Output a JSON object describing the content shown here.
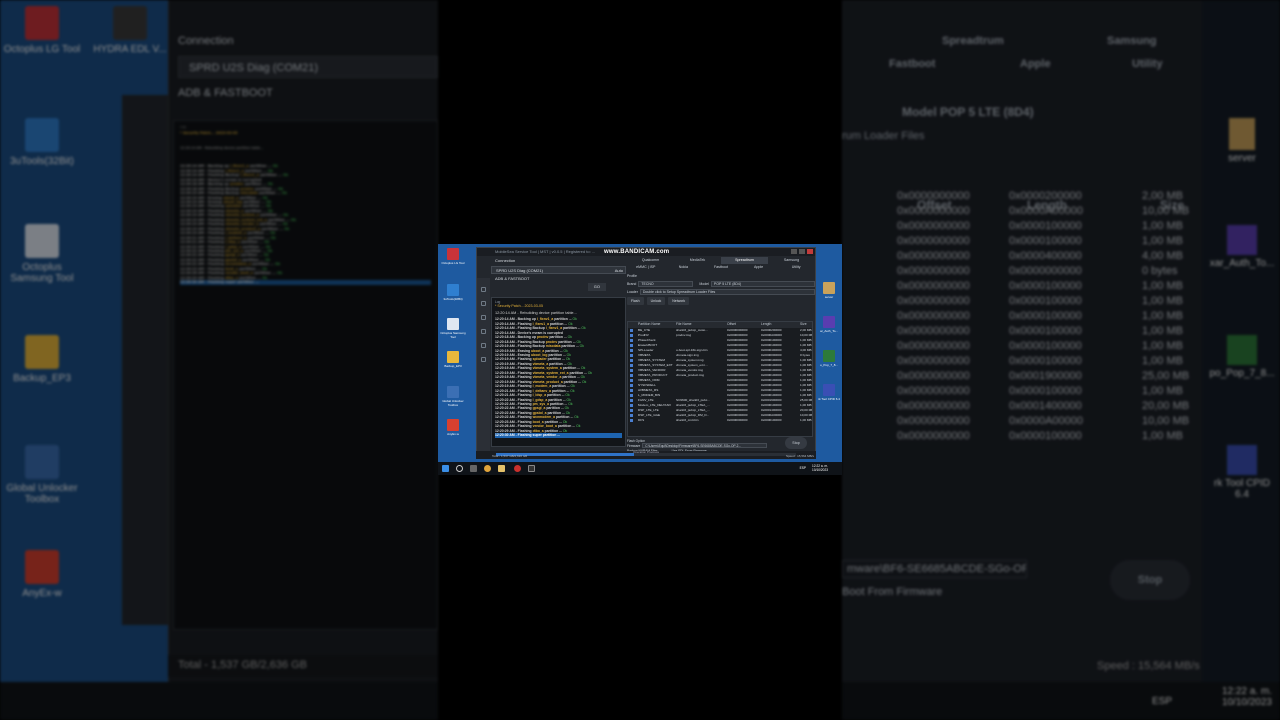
{
  "recording_watermark": "www.BANDICAM.com",
  "left_bg": {
    "connection_label": "Connection",
    "port_value": "SPRD U2S Diag (COM21)",
    "adb_label": "ADB & FASTBOOT",
    "log_label": "Log",
    "security_patch": "* Security Patch... 2023-03-05",
    "desktop_icons": [
      "Octoplus LG Tool",
      "HYDRA EDL V...",
      "3uTools(32Bit)",
      "Octoplus Samsung Tool",
      "Backup_EP3",
      "Global Unlocker Toolbox",
      "AnyEx-w"
    ],
    "total": "Total - 1,537 GB/2,636 GB"
  },
  "right_bg": {
    "tabs_row1": [
      "Spreadtrum",
      "Samsung"
    ],
    "tabs_row2": [
      "Fastboot",
      "Apple",
      "Utility"
    ],
    "model": "Model  POP 5 LTE (8D4)",
    "loader_hint": "rum Loader Files",
    "col_headers": [
      "Offset",
      "Length",
      "Size"
    ],
    "rows": [
      [
        "0x0000000000",
        "0x0000200000",
        "2,00 MB"
      ],
      [
        "0x0000000000",
        "0x0000A00000",
        "10,00 MB"
      ],
      [
        "0x0000000000",
        "0x0000100000",
        "1,00 MB"
      ],
      [
        "0x0000000000",
        "0x0000100000",
        "1,00 MB"
      ],
      [
        "0x0000000000",
        "0x0000400000",
        "4,00 MB"
      ],
      [
        "0x0000000000",
        "0x0000000000",
        "0 bytes"
      ],
      [
        "0x0000000000",
        "0x0000100000",
        "1,00 MB"
      ],
      [
        "0x0000000000",
        "0x0000100000",
        "1,00 MB"
      ],
      [
        "0x0000000000",
        "0x0000100000",
        "1,00 MB"
      ],
      [
        "0x0000000000",
        "0x0000100000",
        "1,00 MB"
      ],
      [
        "0x0000000000",
        "0x0000100000",
        "1,00 MB"
      ],
      [
        "0x0000000000",
        "0x0000100000",
        "1,00 MB"
      ],
      [
        "0x0000000000",
        "0x0001900000",
        "25,00 MB"
      ],
      [
        "0x0000000000",
        "0x0000100000",
        "1,00 MB"
      ],
      [
        "0x0000000000",
        "0x0001400000",
        "20,00 MB"
      ],
      [
        "0x0000000000",
        "0x0000A00000",
        "10,00 MB"
      ],
      [
        "0x0000000000",
        "0x0000100000",
        "1,00 MB"
      ]
    ],
    "firmware_path": "mware\\BF6-SE6685ABCDE-SGo-OP-2",
    "from_firmware": "Boot From Firmware",
    "stop_label": "Stop",
    "speed": "Speed : 15,564 MB/s",
    "clock_time": "12:22 a. m.",
    "clock_date": "10/10/2023",
    "lang": "ESP",
    "desktop_icons": [
      "server",
      "xar_Auth_To...",
      "po_Pop_7_8...",
      "rk Tool CPID 6.4"
    ]
  },
  "app": {
    "title": "MobileSea Service Tool | MST | v0.0.5 | Registered to: ...",
    "connection_label": "Connection",
    "port_value": "SPRD U2S Diag (COM21)",
    "auto_label": "Auto",
    "adb_label": "ADB & FASTBOOT",
    "go_label": "GO",
    "log_label": "Log",
    "security_patch": "* Security Patch... 2023-03-05",
    "log_big": "12:20:14 AM - Rebuilding device partition table...",
    "log_lines": [
      {
        "t": "12:20:14 AM - Backing up ",
        "p": "l_fixnv1_a",
        "r": " partition ... ",
        "ok": "Ok"
      },
      {
        "t": "12:20:14 AM - Flashing ",
        "p": "l_fixnv1_a",
        "r": " partition ... ",
        "ok": "Ok"
      },
      {
        "t": "12:20:14 AM - Flashing Backup ",
        "p": "l_fixnv1_a",
        "r": " partition ... ",
        "ok": "Ok"
      },
      {
        "t": "12:20:14 AM - Device's nvram is currupted",
        "p": "",
        "r": "",
        "ok": ""
      },
      {
        "t": "12:20:18 AM - Backing up ",
        "p": "prodnv",
        "r": " partition ... ",
        "ok": "Ok"
      },
      {
        "t": "12:20:18 AM - Flashing Backup ",
        "p": "prodnv",
        "r": " partition ... ",
        "ok": "Ok"
      },
      {
        "t": "12:20:19 AM - Flashing Backup ",
        "p": "miscdata",
        "r": " partition ... ",
        "ok": "Ok"
      },
      {
        "t": "12:20:19 AM - Erasing ",
        "p": "uboot_a",
        "r": " partition ... ",
        "ok": "Ok"
      },
      {
        "t": "12:20:19 AM - Erasing ",
        "p": "uboot_log",
        "r": " partition ... ",
        "ok": "Ok"
      },
      {
        "t": "12:20:19 AM - Flashing ",
        "p": "sploader",
        "r": " partition ... ",
        "ok": "Ok"
      },
      {
        "t": "12:20:19 AM - Flashing ",
        "p": "vbmeta_a",
        "r": " partition ... ",
        "ok": "Ok"
      },
      {
        "t": "12:20:19 AM - Flashing ",
        "p": "vbmeta_system_a",
        "r": " partition ... ",
        "ok": "Ok"
      },
      {
        "t": "12:20:19 AM - Flashing ",
        "p": "vbmeta_system_ext_a",
        "r": " partition ... ",
        "ok": "Ok"
      },
      {
        "t": "12:20:19 AM - Flashing ",
        "p": "vbmeta_vendor_a",
        "r": " partition ... ",
        "ok": "Ok"
      },
      {
        "t": "12:20:19 AM - Flashing ",
        "p": "vbmeta_product_a",
        "r": " partition ... ",
        "ok": "Ok"
      },
      {
        "t": "12:20:19 AM - Flashing ",
        "p": "l_modem_a",
        "r": " partition ... ",
        "ok": "Ok"
      },
      {
        "t": "12:20:21 AM - Flashing ",
        "p": "l_deltanv_a",
        "r": " partition ... ",
        "ok": "Ok"
      },
      {
        "t": "12:20:21 AM - Flashing ",
        "p": "l_ldsp_a",
        "r": " partition ... ",
        "ok": "Ok"
      },
      {
        "t": "12:20:22 AM - Flashing ",
        "p": "l_gdsp_a",
        "r": " partition ... ",
        "ok": "Ok"
      },
      {
        "t": "12:20:22 AM - Flashing ",
        "p": "pm_sys_a",
        "r": " partition ... ",
        "ok": "Ok"
      },
      {
        "t": "12:20:22 AM - Flashing ",
        "p": "gpsgl_a",
        "r": " partition ... ",
        "ok": "Ok"
      },
      {
        "t": "12:20:22 AM - Flashing ",
        "p": "gpsbd_a",
        "r": " partition ... ",
        "ok": "Ok"
      },
      {
        "t": "12:20:22 AM - Flashing ",
        "p": "wcnmodem_a",
        "r": " partition ... ",
        "ok": "Ok"
      },
      {
        "t": "12:20:23 AM - Flashing ",
        "p": "boot_a",
        "r": " partition ... ",
        "ok": "Ok"
      },
      {
        "t": "12:20:26 AM - Flashing ",
        "p": "vendor_boot_a",
        "r": " partition ... ",
        "ok": "Ok"
      },
      {
        "t": "12:20:29 AM - Flashing ",
        "p": "dtbo_a",
        "r": " partition ... ",
        "ok": "Ok"
      }
    ],
    "log_current": "12:20:30 AM - Flashing super partition ...",
    "tabs_row1": [
      "Qualcomm",
      "MediaTek",
      "Spreadtrum",
      "Samsung"
    ],
    "tabs_row2": [
      "eMMC | ISP",
      "Nokia",
      "Fastboot",
      "Apple",
      "Utility"
    ],
    "profile_label": "Profile",
    "brand_label": "Brand",
    "brand_value": "TECNO",
    "model_label": "Model",
    "model_value": "POP 5 LTE (8D4)",
    "loader_label": "Loader",
    "loader_value": "Double click to Setup Spreadtrum Loader Files",
    "buttons": [
      "Flash",
      "Unlock",
      "Network"
    ],
    "table_headers": [
      "Partition Name",
      "File Name",
      "Offset",
      "Length",
      "Size"
    ],
    "table_rows": [
      [
        "BE_CTE",
        "sharkl3_pubcp_custo...",
        "0x0000000000",
        "0x0000200000",
        "2,00 MB"
      ],
      [
        "ProdNV",
        "prodnv.img",
        "0x0000000000",
        "0x0000A00000",
        "10,00 MB"
      ],
      [
        "PhaseCheck",
        "",
        "0x0000000000",
        "0x0000100000",
        "1,00 MB"
      ],
      [
        "EraseUBOOT",
        "",
        "0x0000000000",
        "0x0000100000",
        "1,00 MB"
      ],
      [
        "SPLLoader",
        "u-boot-spl-16k-sign.bin",
        "0x0000000000",
        "0x0000400000",
        "4,00 MB"
      ],
      [
        "VBMETA",
        "vbmeta-sign.img",
        "0x0000000000",
        "0x0000000000",
        "0 bytes"
      ],
      [
        "VBMETA_SYSTEM",
        "vbmeta_system.img",
        "0x0000000000",
        "0x0000100000",
        "1,00 MB"
      ],
      [
        "VBMETA_SYSTEM_EXT",
        "vbmeta_system_ext.i...",
        "0x0000000000",
        "0x0000100000",
        "1,00 MB"
      ],
      [
        "VBMETA_VENDOR",
        "vbmeta_vendor.img",
        "0x0000000000",
        "0x0000100000",
        "1,00 MB"
      ],
      [
        "VBMETA_PRODUCT",
        "vbmeta_product.img",
        "0x0000000000",
        "0x0000100000",
        "1,00 MB"
      ],
      [
        "VBMETA_ODM",
        "",
        "0x0000000000",
        "0x0000100000",
        "1,00 MB"
      ],
      [
        "SYSFSDELL",
        "",
        "0x0000000000",
        "0x0000100000",
        "1,00 MB"
      ],
      [
        "AVBMETA_RS",
        "",
        "0x0000000000",
        "0x0000100000",
        "1,00 MB"
      ],
      [
        "L_MODEM_BIN",
        "",
        "0x0000000000",
        "0x0000100000",
        "1,00 MB"
      ],
      [
        "FixNV_LTE",
        "SC9600_sharkl3_pubc...",
        "0x0000000000",
        "0x0001900000",
        "25,00 MB"
      ],
      [
        "Modem_LTE_DELTANV",
        "sharkl3_pubcp_LTEA_...",
        "0x0000000000",
        "0x0000100000",
        "1,00 MB"
      ],
      [
        "DSP_LTE_LTE",
        "sharkl3_pubcp_LTEA_...",
        "0x0000000000",
        "0x0001400000",
        "20,00 MB"
      ],
      [
        "DSP_LTE_GGE",
        "sharkl3_pubcp_DM_D...",
        "0x0000000000",
        "0x0000A00000",
        "10,00 MB"
      ],
      [
        "DFS",
        "sharkl3_cm4.bin",
        "0x0000000000",
        "0x0000100000",
        "1,00 MB"
      ]
    ],
    "flash_option_label": "Flash Option",
    "firmware_label": "Firmware",
    "firmware_path": "C:\\Users\\Equil\\Desktop\\Firmware\\BF6-SE6685ABCDE-SGo-OP-2...",
    "options": [
      "Backup NVRAM Files",
      "Use FDL From Firmware",
      "Repartition",
      "Auto Reboot"
    ],
    "stop_label": "Stop",
    "progress_label": "Operation Progress",
    "progress_value": "94%",
    "progress_fraction": 0.46,
    "total": "Total - 1,537 GB/2,636 GB",
    "speed": "Speed : 15,564 MB/s"
  },
  "center_desktop_icons": [
    "Octoplus LG Tool",
    "3uTools(32Bit)",
    "Octoplus Samsung Tool",
    "Backup_EP3",
    "Global Unlocker Toolbox",
    "AnyEx-w"
  ],
  "center_desktop_icons_right": [
    "server",
    "ar_Auth_To...",
    "o_Pop_7_8...",
    "rk Tool CPID 6.4"
  ],
  "center_taskbar": {
    "lang": "ESP",
    "clock_time": "12:22 a. m.",
    "clock_date": "10/10/2023"
  },
  "colors": {
    "desktop_blue": "#1e5aa0",
    "app_bg": "#23272d",
    "log_partition": "#e7b43c",
    "log_ok": "#4ec35b",
    "highlight": "#1e64b0"
  }
}
